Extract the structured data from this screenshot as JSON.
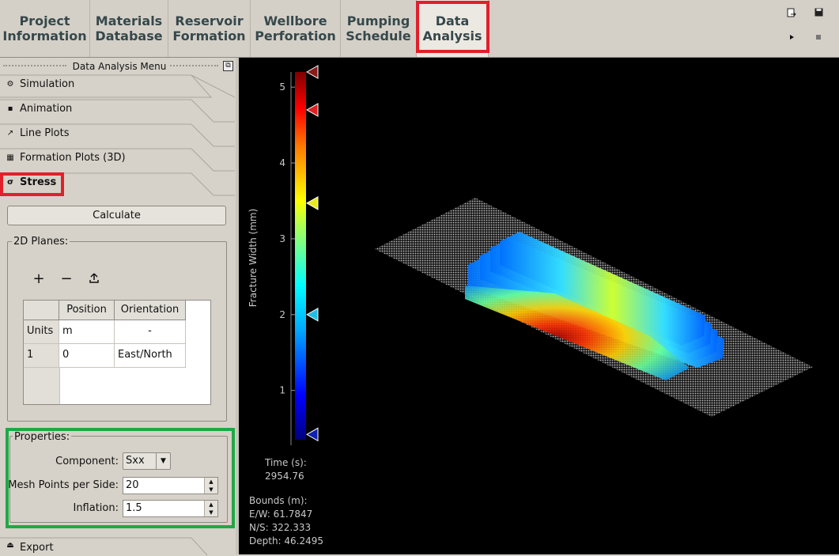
{
  "tabs": [
    {
      "line1": "Project",
      "line2": "Information",
      "active": false
    },
    {
      "line1": "Materials",
      "line2": "Database",
      "active": false
    },
    {
      "line1": "Reservoir",
      "line2": "Formation",
      "active": false
    },
    {
      "line1": "Wellbore",
      "line2": "Perforation",
      "active": false
    },
    {
      "line1": "Pumping",
      "line2": "Schedule",
      "active": false
    },
    {
      "line1": "Data",
      "line2": "Analysis",
      "active": true
    }
  ],
  "toolbar": {
    "icons": [
      "export-icon",
      "save-icon",
      "play-icon",
      "stop-icon"
    ]
  },
  "menu": {
    "title": "Data Analysis Menu",
    "items": [
      {
        "label": "Simulation",
        "icon": "gear-icon"
      },
      {
        "label": "Animation",
        "icon": "film-icon"
      },
      {
        "label": "Line Plots",
        "icon": "line-chart-icon"
      },
      {
        "label": "Formation Plots (3D)",
        "icon": "grid-icon"
      },
      {
        "label": "Stress",
        "icon": "sigma-icon",
        "selected": true
      }
    ],
    "export_label": "Export"
  },
  "stress": {
    "calculate_label": "Calculate",
    "planes_title": "2D Planes:",
    "table": {
      "headers": [
        "",
        "Position",
        "Orientation"
      ],
      "rows": [
        {
          "head": "Units",
          "position": "m",
          "orientation": "-"
        },
        {
          "head": "1",
          "position": "0",
          "orientation": "East/North"
        }
      ]
    },
    "properties": {
      "title": "Properties:",
      "component_label": "Component:",
      "component_value": "Sxx",
      "mesh_label": "Mesh Points per Side:",
      "mesh_value": "20",
      "inflation_label": "Inflation:",
      "inflation_value": "1.5"
    }
  },
  "viewport": {
    "colorbar": {
      "label": "Fracture Width (mm)",
      "ticks": [
        "1",
        "2",
        "3",
        "4",
        "5"
      ],
      "tick_values": [
        1,
        2,
        3,
        4,
        5
      ],
      "min": 0.35,
      "max": 5.2,
      "markers": [
        {
          "value": 5.2,
          "color": "#8a1a1a"
        },
        {
          "value": 4.7,
          "color": "#e02020"
        },
        {
          "value": 3.47,
          "color": "#e8e820"
        },
        {
          "value": 2.0,
          "color": "#20c0e0"
        },
        {
          "value": 0.42,
          "color": "#1020b0"
        }
      ]
    },
    "time_label": "Time (s):",
    "time_value": "2954.76",
    "bounds_label": "Bounds (m):",
    "ew": "E/W: 61.7847",
    "ns": "N/S: 322.333",
    "depth": "Depth: 46.2495"
  },
  "colors": {
    "highlight_red": "#e0202a",
    "highlight_green": "#20a845"
  }
}
